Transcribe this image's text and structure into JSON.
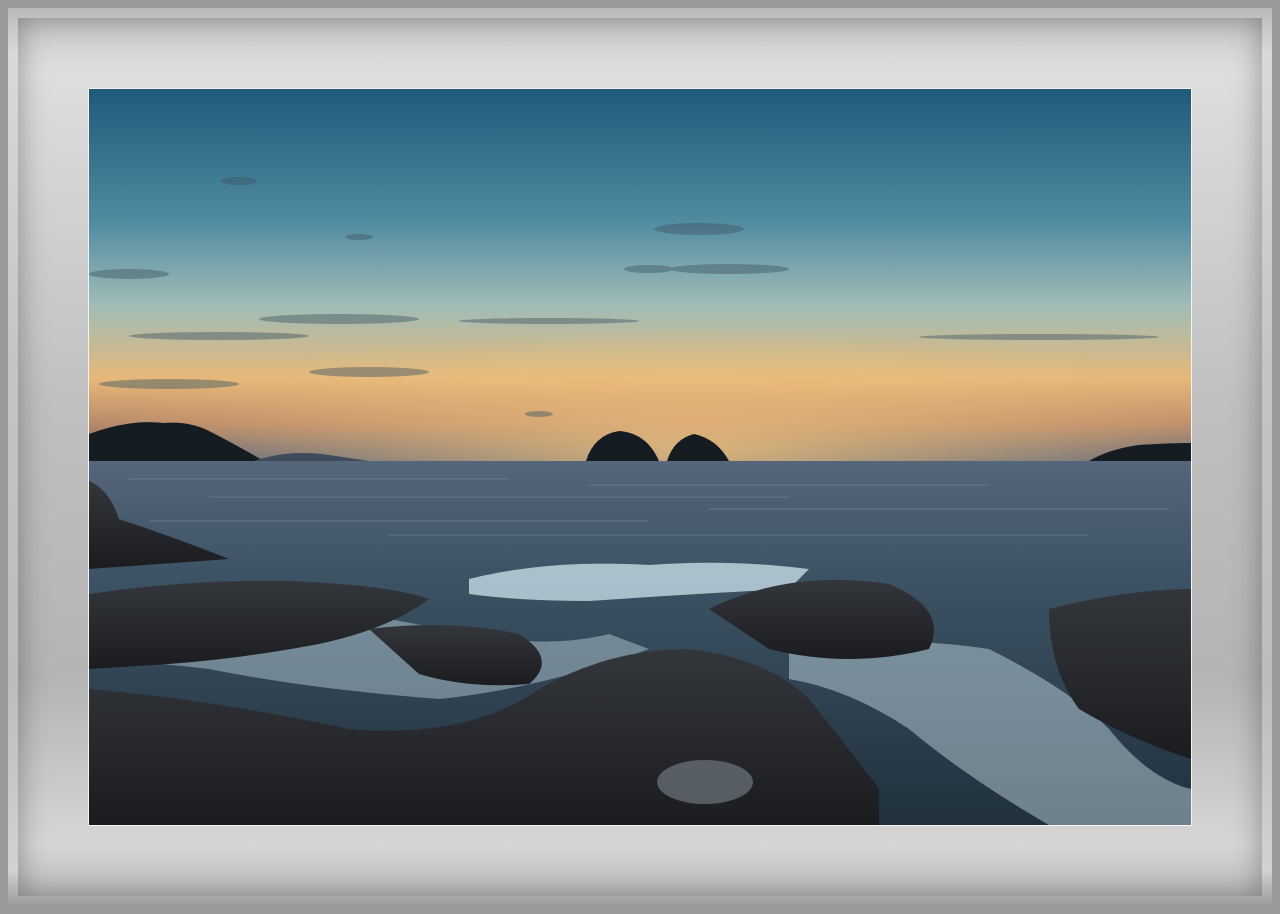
{
  "photo": {
    "subject": "seascape-sunset",
    "colors": {
      "sky_top": "#1f5a7a",
      "sky_mid": "#7fa8b3",
      "horizon_glow": "#e7b372",
      "sea": "#33495a",
      "rock": "#24262a",
      "foam": "#d8eef6",
      "mat": "#c4c4c4",
      "frame_border": "#9a9a9a"
    }
  }
}
